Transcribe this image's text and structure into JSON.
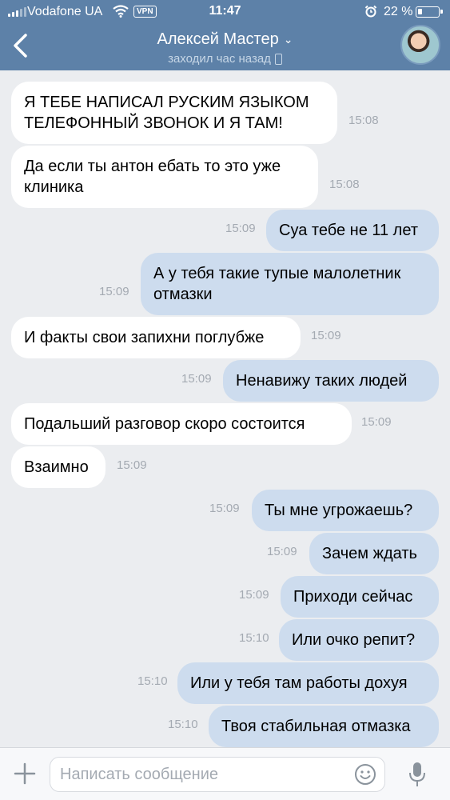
{
  "status_bar": {
    "carrier": "Vodafone UA",
    "vpn": "VPN",
    "time": "11:47",
    "battery": "22 %"
  },
  "header": {
    "contact_name": "Алексей Мастер",
    "last_seen": "заходил час назад"
  },
  "messages": [
    {
      "dir": "in",
      "text": "Я ТЕБЕ НАПИСАЛ РУСКИМ ЯЗЫКОМ ТЕЛЕФОННЫЙ ЗВОНОК И Я ТАМ!",
      "time": "15:08"
    },
    {
      "dir": "in",
      "text": "Да если ты антон ебать то это уже клиника",
      "time": "15:08"
    },
    {
      "dir": "out",
      "text": "Суа тебе не 11 лет",
      "time": "15:09"
    },
    {
      "dir": "out",
      "text": "А у тебя такие тупые малолетник отмазки",
      "time": "15:09"
    },
    {
      "dir": "in",
      "text": "И факты свои запихни поглубже",
      "time": "15:09"
    },
    {
      "dir": "out",
      "text": "Ненавижу таких людей",
      "time": "15:09"
    },
    {
      "dir": "in",
      "text": "Подальший разговор скоро состоится",
      "time": "15:09"
    },
    {
      "dir": "in",
      "text": "Взаимно",
      "time": "15:09"
    },
    {
      "dir": "out",
      "text": "Ты мне угрожаешь?",
      "time": "15:09"
    },
    {
      "dir": "out",
      "text": "Зачем ждать",
      "time": "15:09"
    },
    {
      "dir": "out",
      "text": "Приходи сейчас",
      "time": "15:09"
    },
    {
      "dir": "out",
      "text": "Или очко репит?",
      "time": "15:10"
    },
    {
      "dir": "out",
      "text": "Или у тебя там работы дохуя",
      "time": "15:10"
    },
    {
      "dir": "out",
      "text": "Твоя стабильная отмазка",
      "time": "15:10"
    }
  ],
  "composer": {
    "placeholder": "Написать сообщение"
  },
  "colors": {
    "header": "#5d81a8",
    "background": "#ebedf0",
    "outgoing_bubble": "#cddcee",
    "incoming_bubble": "#ffffff"
  },
  "icons": [
    "signal-icon",
    "wifi-icon",
    "alarm-icon",
    "battery-icon",
    "back-arrow-icon",
    "chevron-down-icon",
    "phone-icon",
    "plus-icon",
    "smile-icon",
    "mic-icon"
  ]
}
